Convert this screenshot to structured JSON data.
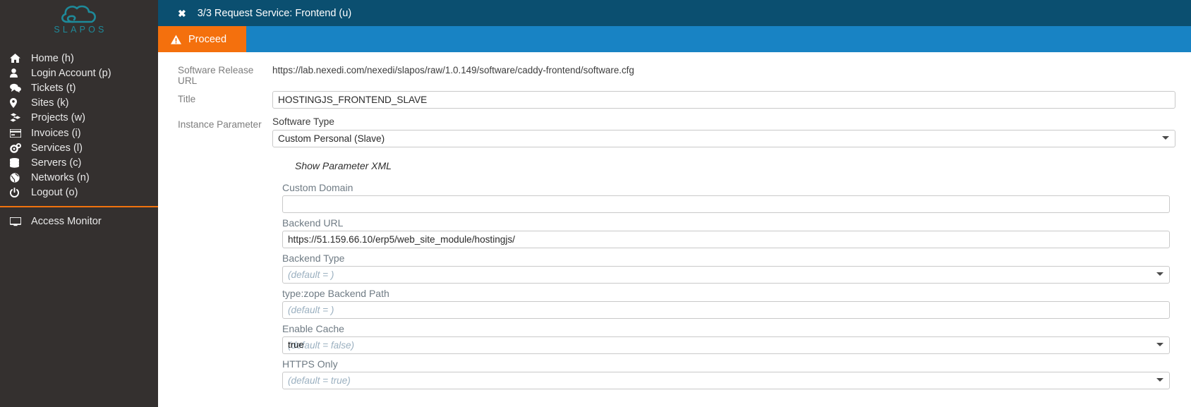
{
  "sidebar": {
    "logo": {
      "text": "SLAPOS",
      "color": "#1e8a9a",
      "icon": "slapos-cloud-logo"
    },
    "items": [
      {
        "label": "Home (h)",
        "icon": "home-icon",
        "key": "home"
      },
      {
        "label": "Login Account (p)",
        "icon": "user-icon",
        "key": "login-account"
      },
      {
        "label": "Tickets (t)",
        "icon": "comments-icon",
        "key": "tickets"
      },
      {
        "label": "Sites (k)",
        "icon": "map-pin-icon",
        "key": "sites"
      },
      {
        "label": "Projects (w)",
        "icon": "cubes-icon",
        "key": "projects"
      },
      {
        "label": "Invoices (i)",
        "icon": "credit-card-icon",
        "key": "invoices"
      },
      {
        "label": "Services (l)",
        "icon": "cogs-icon",
        "key": "services"
      },
      {
        "label": "Servers (c)",
        "icon": "database-icon",
        "key": "servers"
      },
      {
        "label": "Networks (n)",
        "icon": "globe-icon",
        "key": "networks"
      },
      {
        "label": "Logout (o)",
        "icon": "power-icon",
        "key": "logout"
      }
    ],
    "divider_color": "#f0720e",
    "bottom_items": [
      {
        "label": "Access Monitor",
        "icon": "monitor-icon",
        "key": "access-monitor"
      }
    ]
  },
  "titlebar": {
    "close_glyph": "✖",
    "title": "3/3 Request Service: Frontend (u)",
    "background": "#0b4f70"
  },
  "actionbar": {
    "background": "#1883c4",
    "proceed": {
      "label": "Proceed",
      "icon": "warning-triangle-icon",
      "background": "#f4700d"
    }
  },
  "form": {
    "software_release_url": {
      "label": "Software Release URL",
      "value": "https://lab.nexedi.com/nexedi/slapos/raw/1.0.149/software/caddy-frontend/software.cfg"
    },
    "title": {
      "label": "Title",
      "value": "HOSTINGJS_FRONTEND_SLAVE"
    },
    "instance_parameter": {
      "label": "Instance Parameter",
      "software_type": {
        "label": "Software Type",
        "value": "Custom Personal (Slave)"
      },
      "show_parameter_xml": "Show Parameter XML",
      "parameters": [
        {
          "label": "Custom Domain",
          "kind": "text",
          "value": "",
          "placeholder": ""
        },
        {
          "label": "Backend URL",
          "kind": "text",
          "value": "https://51.159.66.10/erp5/web_site_module/hostingjs/",
          "placeholder": ""
        },
        {
          "label": "Backend Type",
          "kind": "select",
          "value": "",
          "placeholder": "(default = )"
        },
        {
          "label": "type:zope Backend Path",
          "kind": "text",
          "value": "",
          "placeholder": "(default = )"
        },
        {
          "label": "Enable Cache",
          "kind": "select",
          "value": "true",
          "placeholder": "(default = false)"
        },
        {
          "label": "HTTPS Only",
          "kind": "select",
          "value": "",
          "placeholder": "(default = true)"
        }
      ]
    }
  }
}
